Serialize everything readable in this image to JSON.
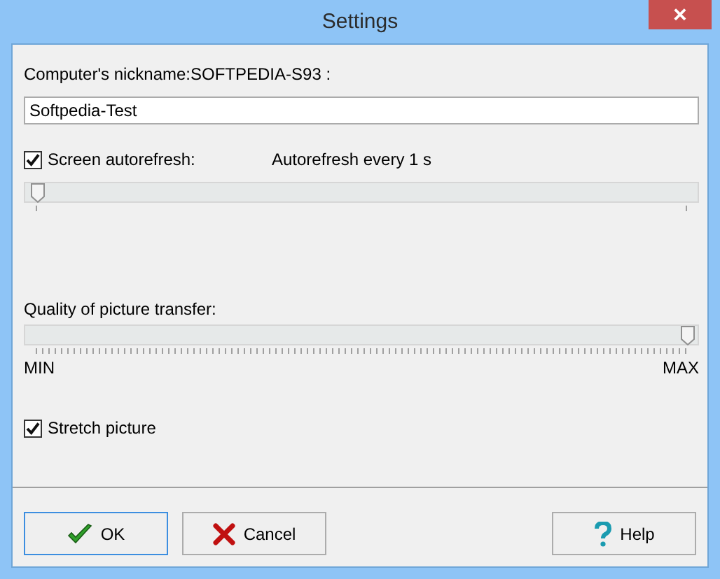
{
  "window": {
    "title": "Settings",
    "close": "×"
  },
  "nickname": {
    "label": "Computer's nickname:SOFTPEDIA-S93  :",
    "value": "Softpedia-Test"
  },
  "autorefresh": {
    "label": "Screen autorefresh:",
    "checked": true,
    "reading": "Autorefresh every 1 s"
  },
  "refresh_slider": {
    "kind": "ends",
    "level": 0
  },
  "quality": {
    "label": "Quality of picture transfer:"
  },
  "quality_slider": {
    "kind": "fine",
    "level": 1,
    "min_label": "MIN",
    "max_label": "MAX"
  },
  "stretch": {
    "label": "Stretch picture",
    "checked": true
  },
  "buttons": [
    {
      "kind": "ok",
      "label": "OK",
      "focused": true
    },
    {
      "kind": "cancel",
      "label": "Cancel",
      "focused": false
    },
    {
      "kind": "help",
      "label": "Help",
      "focused": false
    }
  ]
}
